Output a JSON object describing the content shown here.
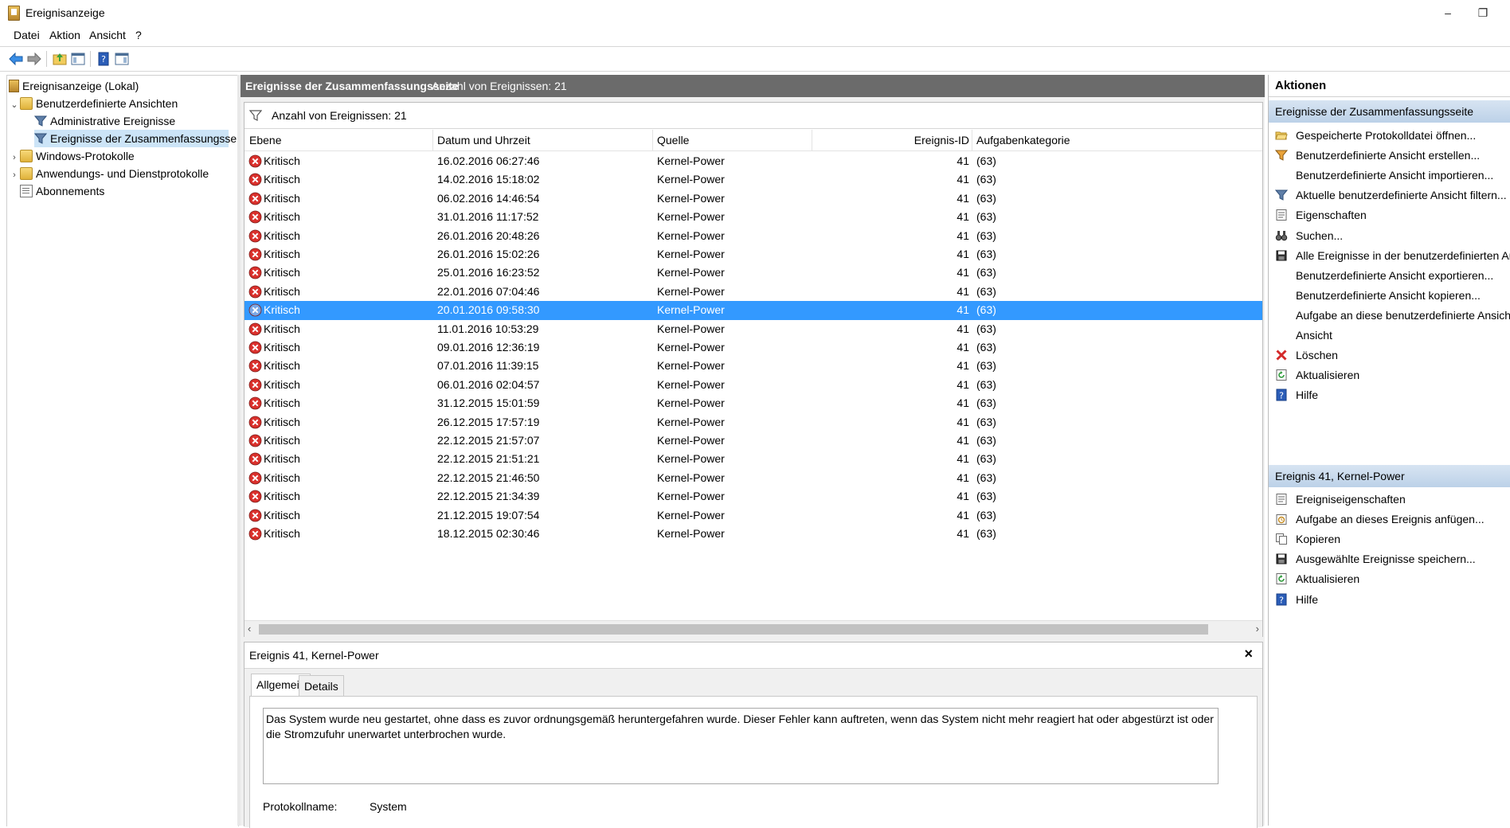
{
  "window": {
    "title": "Ereignisanzeige",
    "minimize": "–",
    "restore": "❐"
  },
  "menu": [
    "Datei",
    "Aktion",
    "Ansicht",
    "?"
  ],
  "tree": {
    "root": "Ereignisanzeige (Lokal)",
    "custom_views": "Benutzerdefinierte Ansichten",
    "admin_events": "Administrative Ereignisse",
    "summary_events": "Ereignisse der Zusammenfassungsseite",
    "windows_logs": "Windows-Protokolle",
    "app_logs": "Anwendungs- und Dienstprotokolle",
    "subscriptions": "Abonnements"
  },
  "center": {
    "header_title": "Ereignisse der Zusammenfassungsseite",
    "header_count": "Anzahl von Ereignissen: 21",
    "filter_text": "Anzahl von Ereignissen: 21",
    "columns": [
      "Ebene",
      "Datum und Uhrzeit",
      "Quelle",
      "Ereignis-ID",
      "Aufgabenkategorie"
    ],
    "rows": [
      {
        "level": "Kritisch",
        "date": "16.02.2016 06:27:46",
        "source": "Kernel-Power",
        "id": "41",
        "category": "(63)"
      },
      {
        "level": "Kritisch",
        "date": "14.02.2016 15:18:02",
        "source": "Kernel-Power",
        "id": "41",
        "category": "(63)"
      },
      {
        "level": "Kritisch",
        "date": "06.02.2016 14:46:54",
        "source": "Kernel-Power",
        "id": "41",
        "category": "(63)"
      },
      {
        "level": "Kritisch",
        "date": "31.01.2016 11:17:52",
        "source": "Kernel-Power",
        "id": "41",
        "category": "(63)"
      },
      {
        "level": "Kritisch",
        "date": "26.01.2016 20:48:26",
        "source": "Kernel-Power",
        "id": "41",
        "category": "(63)"
      },
      {
        "level": "Kritisch",
        "date": "26.01.2016 15:02:26",
        "source": "Kernel-Power",
        "id": "41",
        "category": "(63)"
      },
      {
        "level": "Kritisch",
        "date": "25.01.2016 16:23:52",
        "source": "Kernel-Power",
        "id": "41",
        "category": "(63)"
      },
      {
        "level": "Kritisch",
        "date": "22.01.2016 07:04:46",
        "source": "Kernel-Power",
        "id": "41",
        "category": "(63)"
      },
      {
        "level": "Kritisch",
        "date": "20.01.2016 09:58:30",
        "source": "Kernel-Power",
        "id": "41",
        "category": "(63)"
      },
      {
        "level": "Kritisch",
        "date": "11.01.2016 10:53:29",
        "source": "Kernel-Power",
        "id": "41",
        "category": "(63)"
      },
      {
        "level": "Kritisch",
        "date": "09.01.2016 12:36:19",
        "source": "Kernel-Power",
        "id": "41",
        "category": "(63)"
      },
      {
        "level": "Kritisch",
        "date": "07.01.2016 11:39:15",
        "source": "Kernel-Power",
        "id": "41",
        "category": "(63)"
      },
      {
        "level": "Kritisch",
        "date": "06.01.2016 02:04:57",
        "source": "Kernel-Power",
        "id": "41",
        "category": "(63)"
      },
      {
        "level": "Kritisch",
        "date": "31.12.2015 15:01:59",
        "source": "Kernel-Power",
        "id": "41",
        "category": "(63)"
      },
      {
        "level": "Kritisch",
        "date": "26.12.2015 17:57:19",
        "source": "Kernel-Power",
        "id": "41",
        "category": "(63)"
      },
      {
        "level": "Kritisch",
        "date": "22.12.2015 21:57:07",
        "source": "Kernel-Power",
        "id": "41",
        "category": "(63)"
      },
      {
        "level": "Kritisch",
        "date": "22.12.2015 21:51:21",
        "source": "Kernel-Power",
        "id": "41",
        "category": "(63)"
      },
      {
        "level": "Kritisch",
        "date": "22.12.2015 21:46:50",
        "source": "Kernel-Power",
        "id": "41",
        "category": "(63)"
      },
      {
        "level": "Kritisch",
        "date": "22.12.2015 21:34:39",
        "source": "Kernel-Power",
        "id": "41",
        "category": "(63)"
      },
      {
        "level": "Kritisch",
        "date": "21.12.2015 19:07:54",
        "source": "Kernel-Power",
        "id": "41",
        "category": "(63)"
      },
      {
        "level": "Kritisch",
        "date": "18.12.2015 02:30:46",
        "source": "Kernel-Power",
        "id": "41",
        "category": "(63)"
      }
    ],
    "selected_row": 8
  },
  "detail": {
    "title": "Ereignis 41, Kernel-Power",
    "close": "×",
    "tabs": [
      "Allgemein",
      "Details"
    ],
    "description": "Das System wurde neu gestartet, ohne dass es zuvor ordnungsgemäß heruntergefahren wurde. Dieser Fehler kann auftreten, wenn das System nicht mehr reagiert hat oder abgestürzt ist oder die Stromzufuhr unerwartet unterbrochen wurde.",
    "log_label": "Protokollname:",
    "log_value": "System"
  },
  "actions": {
    "title": "Aktionen",
    "section1": "Ereignisse der Zusammenfassungsseite",
    "items1": [
      {
        "label": "Gespeicherte Protokolldatei öffnen...",
        "icon": "folder-open-icon"
      },
      {
        "label": "Benutzerdefinierte Ansicht erstellen...",
        "icon": "filter-create-icon"
      },
      {
        "label": "Benutzerdefinierte Ansicht importieren...",
        "icon": ""
      },
      {
        "label": "Aktuelle benutzerdefinierte Ansicht filtern...",
        "icon": "filter-icon"
      },
      {
        "label": "Eigenschaften",
        "icon": "properties-icon"
      },
      {
        "label": "Suchen...",
        "icon": "binoculars-icon"
      },
      {
        "label": "Alle Ereignisse in der benutzerdefinierten Ansicht s",
        "icon": "save-icon"
      },
      {
        "label": "Benutzerdefinierte Ansicht exportieren...",
        "icon": ""
      },
      {
        "label": "Benutzerdefinierte Ansicht kopieren...",
        "icon": ""
      },
      {
        "label": "Aufgabe an diese benutzerdefinierte Ansicht anfüg",
        "icon": ""
      },
      {
        "label": "Ansicht",
        "icon": ""
      },
      {
        "label": "Löschen",
        "icon": "delete-icon"
      },
      {
        "label": "Aktualisieren",
        "icon": "refresh-icon"
      },
      {
        "label": "Hilfe",
        "icon": "help-icon"
      }
    ],
    "section2": "Ereignis 41, Kernel-Power",
    "items2": [
      {
        "label": "Ereigniseigenschaften",
        "icon": "properties-icon"
      },
      {
        "label": "Aufgabe an dieses Ereignis anfügen...",
        "icon": "task-icon"
      },
      {
        "label": "Kopieren",
        "icon": "copy-icon"
      },
      {
        "label": "Ausgewählte Ereignisse speichern...",
        "icon": "save-icon"
      },
      {
        "label": "Aktualisieren",
        "icon": "refresh-icon"
      },
      {
        "label": "Hilfe",
        "icon": "help-icon"
      }
    ]
  },
  "colors": {
    "accent": "#3399ff",
    "header_gray": "#6b6b6b",
    "critical_red": "#d9302c"
  }
}
